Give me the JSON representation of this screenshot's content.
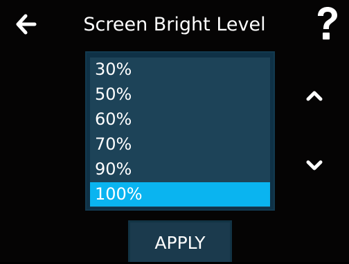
{
  "header": {
    "title": "Screen Bright Level",
    "back_icon": "arrow-left-icon",
    "help_icon": "question-mark-icon"
  },
  "brightness_list": {
    "items": [
      {
        "label": "30%"
      },
      {
        "label": "50%"
      },
      {
        "label": "60%"
      },
      {
        "label": "70%"
      },
      {
        "label": "90%"
      },
      {
        "label": "100%"
      }
    ],
    "selected_value": "100%"
  },
  "scroll": {
    "up_icon": "chevron-up-icon",
    "down_icon": "chevron-down-icon"
  },
  "footer": {
    "apply_label": "APPLY"
  },
  "colors": {
    "background": "#050404",
    "list_background": "#1d4358",
    "selected_highlight": "#0ab4f0",
    "button_background": "#1b3a4d",
    "text": "#ffffff"
  }
}
